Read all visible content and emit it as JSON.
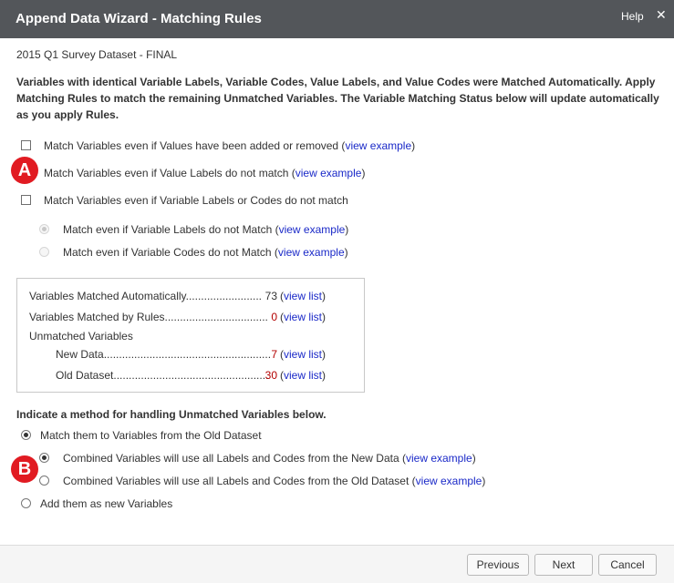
{
  "window": {
    "title": "Append Data Wizard - Matching Rules",
    "help_label": "Help",
    "close_glyph": "✕"
  },
  "dataset_name": "2015 Q1 Survey Dataset - FINAL",
  "description": "Variables with identical Variable Labels, Variable Codes, Value Labels, and Value Codes were Matched Automatically. Apply Matching Rules to match the remaining Unmatched Variables. The Variable Matching Status below will update automatically as you apply Rules.",
  "rules": [
    {
      "label": "Match Variables even if Values have been added or removed",
      "link": "view example",
      "checked": false
    },
    {
      "label": "Match Variables even if Value Labels do not match",
      "link": "view example",
      "checked": false
    },
    {
      "label": "Match Variables even if Variable Labels or Codes do not match",
      "checked": false
    }
  ],
  "sub_rules": [
    {
      "label": "Match even if Variable Labels do not Match",
      "link": "view example",
      "selected": true,
      "enabled": false
    },
    {
      "label": "Match even if Variable Codes do not Match",
      "link": "view example",
      "selected": false,
      "enabled": false
    }
  ],
  "status": {
    "auto": {
      "label": "Variables Matched Automatically.........................",
      "count": "73",
      "link": "view list"
    },
    "rules": {
      "label": "Variables Matched by Rules..................................",
      "count": "0",
      "link": "view list"
    },
    "unmatched_header": "Unmatched Variables",
    "new_data": {
      "label": "New Data.......................................................",
      "count": "7",
      "link": "view list"
    },
    "old_dataset": {
      "label": "Old Dataset...................................................",
      "count": "30",
      "link": "view list"
    }
  },
  "method_header": "Indicate a method for handling Unmatched Variables below.",
  "methods": [
    {
      "label": "Match them to Variables from the Old Dataset",
      "selected": true
    },
    {
      "label": "Add them as new Variables",
      "selected": false
    }
  ],
  "method_sub": [
    {
      "label": "Combined Variables will use all Labels and Codes from the New Data",
      "link": "view example",
      "selected": true
    },
    {
      "label": "Combined Variables will use all Labels and Codes from the Old Dataset",
      "link": "view example",
      "selected": false
    }
  ],
  "badges": {
    "a": "A",
    "b": "B",
    "color": "#e11b22"
  },
  "buttons": {
    "previous": "Previous",
    "next": "Next",
    "cancel": "Cancel"
  },
  "punct": {
    "open": " (",
    "close": ")"
  }
}
